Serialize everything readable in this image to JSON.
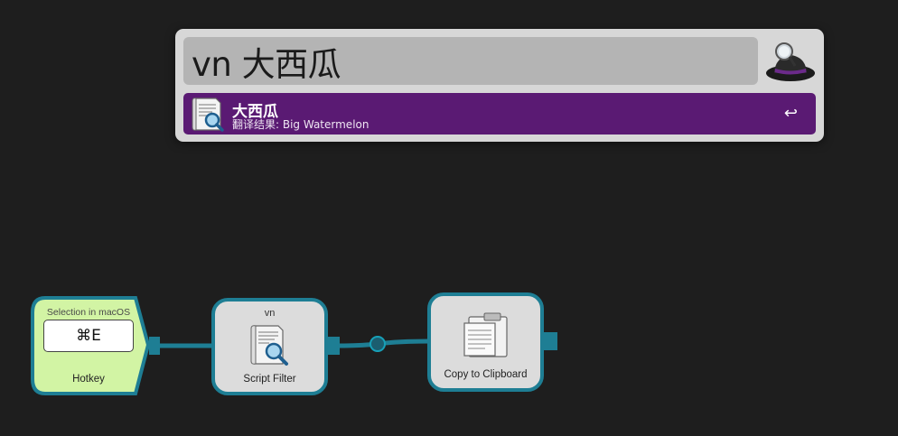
{
  "alfred": {
    "query": "vn 大西瓜",
    "result": {
      "title": "大西瓜",
      "subtitle": "翻译结果: Big Watermelon",
      "action_glyph": "↩"
    }
  },
  "workflow": {
    "hotkey": {
      "argument": "Selection in macOS",
      "shortcut": "⌘E",
      "label": "Hotkey",
      "color": "#d2f4a4"
    },
    "script_filter": {
      "keyword": "vn",
      "label": "Script Filter"
    },
    "clipboard": {
      "label": "Copy to Clipboard"
    },
    "connector_color": "#1e7e94"
  }
}
